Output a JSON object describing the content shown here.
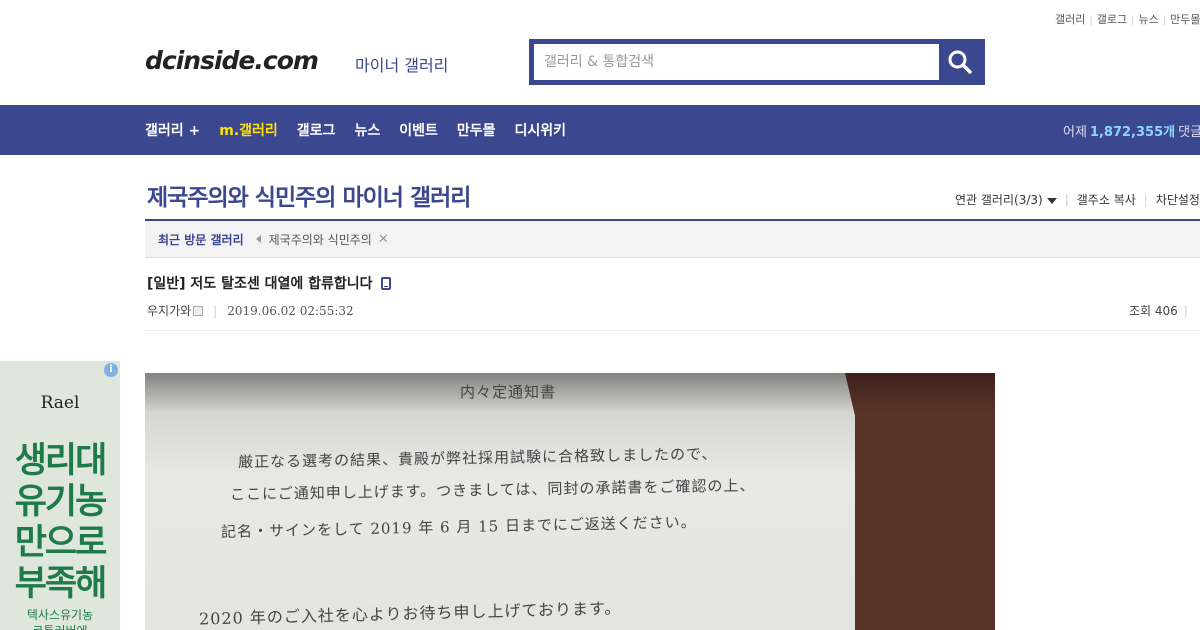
{
  "topbar": {
    "links": [
      "갤러리",
      "갤로그",
      "뉴스",
      "만두몰"
    ]
  },
  "header": {
    "logo": "dcinside.com",
    "logo_sub": "마이너 갤러리",
    "search_placeholder": "갤러리 & 통합검색"
  },
  "nav": {
    "items": [
      "갤러리 +",
      "m.갤러리",
      "갤로그",
      "뉴스",
      "이벤트",
      "만두몰",
      "디시위키"
    ],
    "stats_label": "어제",
    "stats_value": "1,872,355개",
    "stats_suffix": "댓글"
  },
  "gallery": {
    "title": "제국주의와 식민주의 마이너 갤러리",
    "links": [
      "연관 갤러리(3/3)",
      "갤주소 복사",
      "차단설정"
    ]
  },
  "recent": {
    "label": "최근 방문 갤러리",
    "item": "제국주의와 식민주의"
  },
  "post": {
    "title": "[일반] 저도 탈조센 대열에 합류합니다",
    "author": "우지가와",
    "date": "2019.06.02 02:55:32",
    "views": "조회 406"
  },
  "ad": {
    "brand": "Rael",
    "copy": [
      "생리대",
      "유기농",
      "만으로",
      "부족해"
    ],
    "small": "텍사스유기농\n코튼커버에"
  },
  "document": {
    "heading": "内々定通知書",
    "lines": [
      "厳正なる選考の結果、貴殿が弊社採用試験に合格致しましたので、",
      "ここにご通知申し上げます。つきましては、同封の承諾書をご確認の上、",
      "記名・サインをして 2019 年 6 月 15 日までにご返送ください。",
      "2020 年のご入社を心よりお待ち申し上げております。"
    ]
  },
  "colors": {
    "brand": "#3b4890",
    "highlight": "#ffe300",
    "stat": "#8ed4ff"
  },
  "icons": [
    "search-icon",
    "caret-down-icon",
    "arrow-left-icon",
    "close-icon",
    "mobile-icon",
    "nickname-icon",
    "info-icon"
  ]
}
